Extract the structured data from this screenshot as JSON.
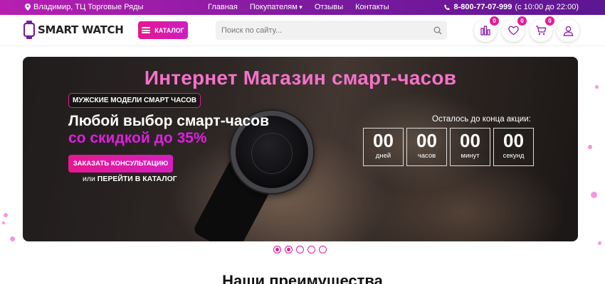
{
  "topbar": {
    "location": "Владимир, ТЦ Торговые Ряды",
    "nav": [
      "Главная",
      "Покупателям",
      "Отзывы",
      "Контакты"
    ],
    "phone": "8-800-77-07-999",
    "hours": "(с 10:00 до 22:00)"
  },
  "header": {
    "logo_text": "SMART WATCH",
    "catalog_label": "КАТАЛОГ",
    "search_placeholder": "Поиск по сайту...",
    "counters": {
      "compare": "0",
      "favorites": "0",
      "cart": "0"
    }
  },
  "hero": {
    "title": "Интернет Магазин смарт-часов",
    "tag": "МУЖСКИЕ МОДЕЛИ СМАРТ ЧАСОВ",
    "headline_line1": "Любой выбор смарт-часов",
    "headline_line2": "со скидкой до 35%",
    "consult_button": "ЗАКАЗАТЬ КОНСУЛЬТАЦИЮ",
    "catalog_link_prefix": "или",
    "catalog_link": "ПЕРЕЙТИ В КАТАЛОГ",
    "countdown_label": "Осталось до конца акции:",
    "countdown": [
      {
        "value": "00",
        "unit": "дней"
      },
      {
        "value": "00",
        "unit": "часов"
      },
      {
        "value": "00",
        "unit": "минут"
      },
      {
        "value": "00",
        "unit": "секунд"
      }
    ],
    "slides_total": 5,
    "slides_active": [
      1,
      2
    ]
  },
  "section": {
    "title": "Наши преимущества"
  },
  "colors": {
    "accent": "#e11d9a",
    "topbar_start": "#b81fb1",
    "topbar_end": "#5e1691"
  }
}
